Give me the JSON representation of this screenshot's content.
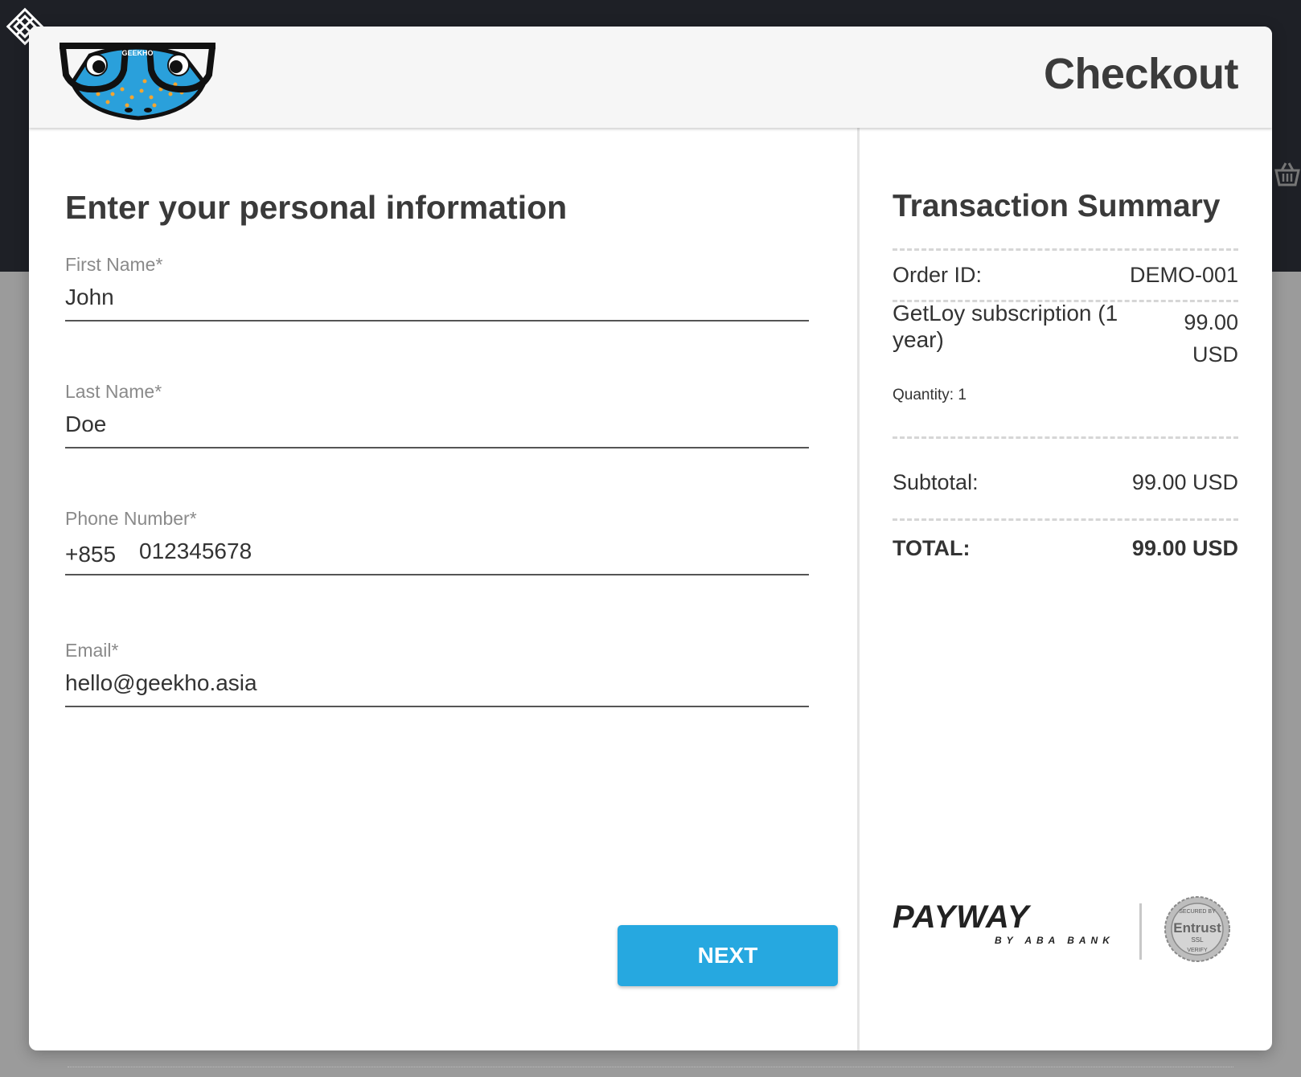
{
  "header": {
    "title": "Checkout",
    "logo_text": "GEEKHO"
  },
  "form": {
    "heading": "Enter your personal information",
    "first_name": {
      "label": "First Name*",
      "value": "John"
    },
    "last_name": {
      "label": "Last Name*",
      "value": "Doe"
    },
    "phone": {
      "label": "Phone Number*",
      "country_code": "+855",
      "value": "012345678"
    },
    "email": {
      "label": "Email*",
      "value": "hello@geekho.asia"
    },
    "next_label": "NEXT"
  },
  "summary": {
    "heading": "Transaction Summary",
    "order_id_label": "Order ID:",
    "order_id": "DEMO-001",
    "item_name": "GetLoy subscription (1 year)",
    "item_quantity": "Quantity: 1",
    "item_price_amount": "99.00",
    "item_price_currency": "USD",
    "subtotal_label": "Subtotal:",
    "subtotal": "99.00 USD",
    "total_label": "TOTAL:",
    "total": "99.00 USD"
  },
  "branding": {
    "payway_text": "PAYWAY",
    "payway_sub": "BY ABA BANK",
    "seal_top": "SECURED BY",
    "seal_main": "Entrust",
    "seal_ssl": "SSL",
    "seal_bottom": "VERIFY"
  },
  "colors": {
    "accent": "#26a8e0",
    "page_dark": "#1e2026",
    "overlay": "#9b9b9b"
  },
  "icons": {
    "background_logo": "knot-logo-icon",
    "background_cart": "basket-icon"
  }
}
